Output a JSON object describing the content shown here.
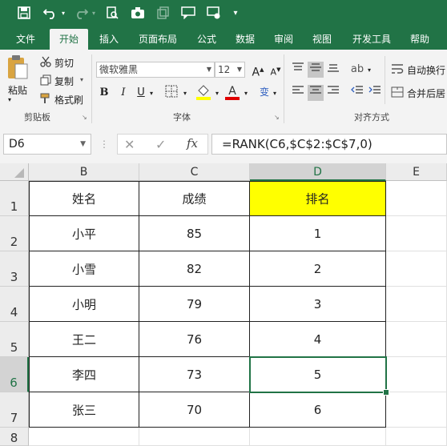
{
  "qat": {
    "icons": [
      "save-icon",
      "undo-icon",
      "redo-icon",
      "print-preview-icon",
      "camera-icon",
      "copy-icon",
      "comment-icon",
      "camera-settings-icon",
      "customize-qat-icon"
    ]
  },
  "tabs": [
    "文件",
    "开始",
    "插入",
    "页面布局",
    "公式",
    "数据",
    "审阅",
    "视图",
    "开发工具",
    "帮助"
  ],
  "active_tab": "开始",
  "ribbon": {
    "clipboard": {
      "paste": "粘贴",
      "cut": "剪切",
      "copy": "复制",
      "format_painter": "格式刷",
      "label": "剪贴板"
    },
    "font": {
      "name": "微软雅黑",
      "size": "12",
      "label": "字体"
    },
    "alignment": {
      "wrap": "自动换行",
      "merge": "合并后居",
      "label": "对齐方式"
    }
  },
  "formula_bar": {
    "name_box": "D6",
    "cancel": "✕",
    "enter": "✓",
    "fx": "fx",
    "formula": "=RANK(C6,$C$2:$C$7,0)"
  },
  "columns": [
    "B",
    "C",
    "D",
    "E"
  ],
  "rows": [
    "1",
    "2",
    "3",
    "4",
    "5",
    "6",
    "7",
    "8"
  ],
  "table": {
    "headers": [
      "姓名",
      "成绩",
      "排名"
    ],
    "rows": [
      [
        "小平",
        "85",
        "1"
      ],
      [
        "小雪",
        "82",
        "2"
      ],
      [
        "小明",
        "79",
        "3"
      ],
      [
        "王二",
        "76",
        "4"
      ],
      [
        "李四",
        "73",
        "5"
      ],
      [
        "张三",
        "70",
        "6"
      ]
    ]
  },
  "active_cell": "D6",
  "colors": {
    "excel_green": "#217346",
    "highlight": "#ffff00"
  }
}
